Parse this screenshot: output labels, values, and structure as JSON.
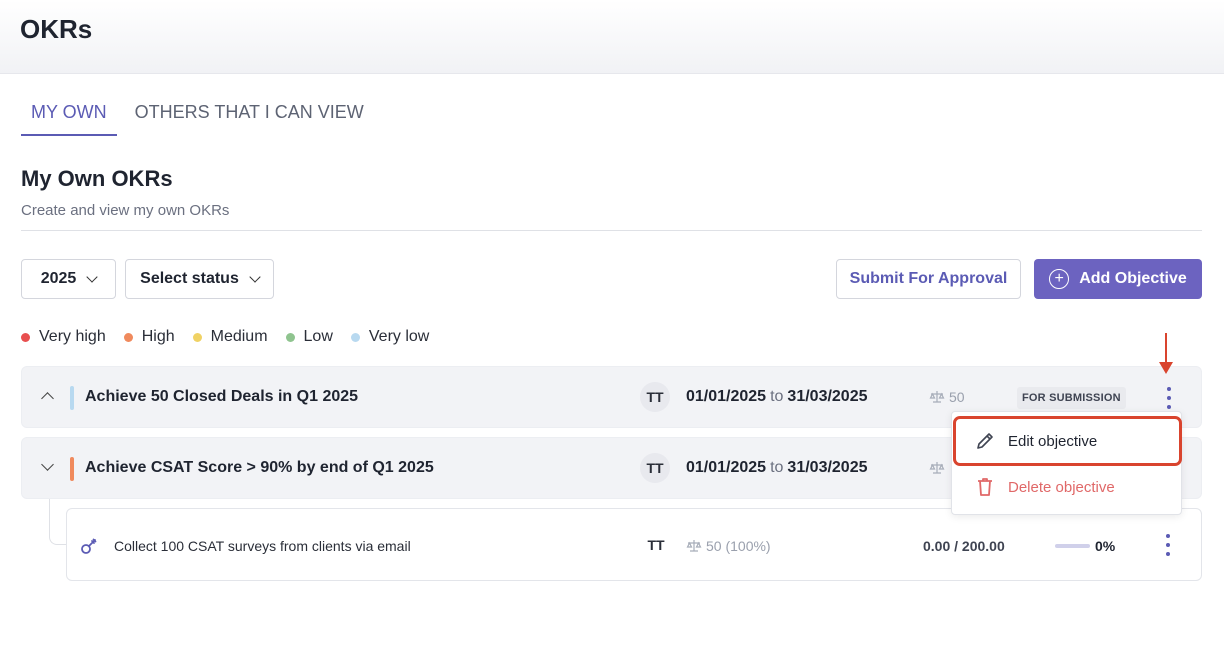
{
  "header": {
    "title": "OKRs"
  },
  "tabs": [
    {
      "label": "MY OWN",
      "active": true
    },
    {
      "label": "OTHERS THAT I CAN VIEW",
      "active": false
    }
  ],
  "section": {
    "title": "My Own OKRs",
    "subtitle": "Create and view my own OKRs"
  },
  "toolbar": {
    "year": "2025",
    "status_placeholder": "Select status",
    "submit_label": "Submit For Approval",
    "add_label": "Add Objective"
  },
  "legend": [
    {
      "label": "Very high",
      "color": "#e84f4f"
    },
    {
      "label": "High",
      "color": "#f08a5d"
    },
    {
      "label": "Medium",
      "color": "#f0d264"
    },
    {
      "label": "Low",
      "color": "#8fc48f"
    },
    {
      "label": "Very low",
      "color": "#b8d9f0"
    }
  ],
  "objectives": [
    {
      "title": "Achieve 50 Closed Deals in Q1 2025",
      "priority_color": "#b8d9f0",
      "owner": "TT",
      "start": "01/01/2025",
      "to": "to",
      "end": "31/03/2025",
      "weight": "50",
      "status": "FOR SUBMISSION"
    },
    {
      "title": "Achieve CSAT Score > 90% by end of Q1 2025",
      "priority_color": "#f08a5d",
      "owner": "TT",
      "start": "01/01/2025",
      "to": "to",
      "end": "31/03/2025"
    }
  ],
  "key_result": {
    "title": "Collect 100 CSAT surveys from clients via email",
    "owner": "TT",
    "weight": "50 (100%)",
    "progress_text": "0.00 / 200.00",
    "progress_fraction": 0,
    "progress_pct": "0%"
  },
  "menu": {
    "edit_label": "Edit objective",
    "delete_label": "Delete objective"
  },
  "icons": {
    "plus": "+"
  }
}
